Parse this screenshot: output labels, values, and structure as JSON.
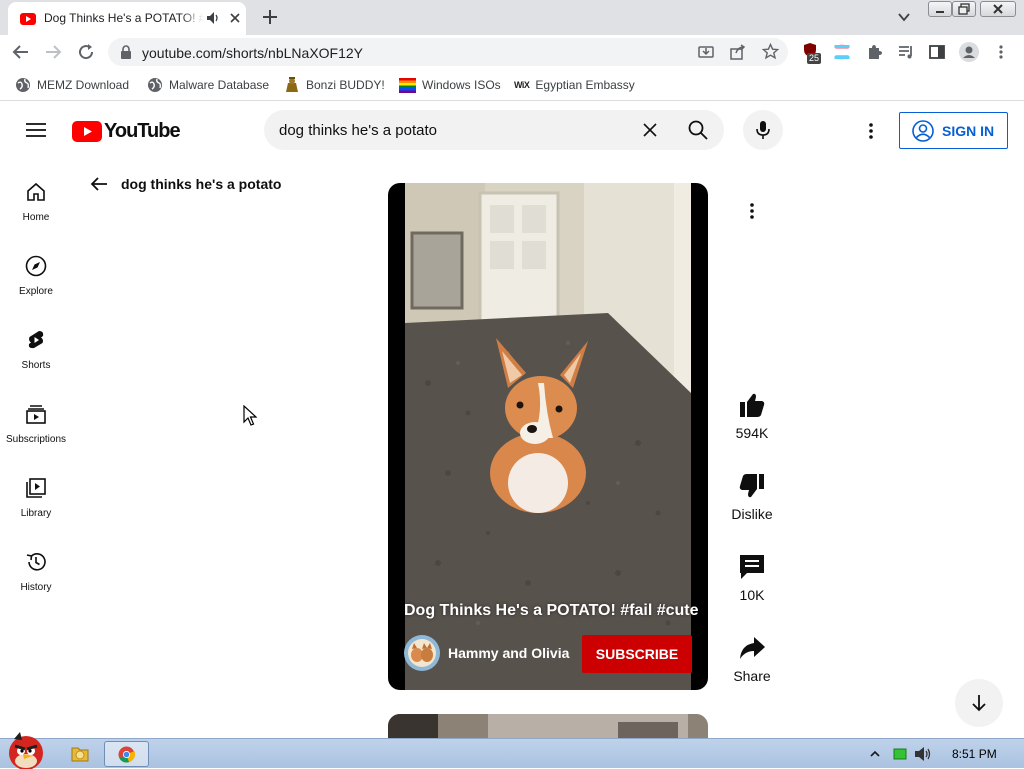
{
  "browser": {
    "tab": {
      "title": "Dog Thinks He's a POTATO! #fail #cute - YouTube"
    },
    "url": "youtube.com/shorts/nbLNaXOF12Y",
    "extension_badge": "25",
    "bookmarks": [
      {
        "label": "MEMZ Download",
        "icon": "globe-icon"
      },
      {
        "label": "Malware Database",
        "icon": "globe-icon"
      },
      {
        "label": "Bonzi BUDDY!",
        "icon": "bonzi-icon"
      },
      {
        "label": "Windows ISOs",
        "icon": "rainbow-flag-icon"
      },
      {
        "label": "Egyptian Embassy",
        "icon": "wix-icon"
      }
    ]
  },
  "youtube": {
    "logo_text": "YouTube",
    "search_query": "dog thinks he's a potato",
    "signin_label": "SIGN IN",
    "guide": [
      {
        "label": "Home",
        "icon": "home-icon"
      },
      {
        "label": "Explore",
        "icon": "compass-icon"
      },
      {
        "label": "Shorts",
        "icon": "shorts-icon"
      },
      {
        "label": "Subscriptions",
        "icon": "subscriptions-icon"
      },
      {
        "label": "Library",
        "icon": "library-icon"
      },
      {
        "label": "History",
        "icon": "history-icon"
      }
    ],
    "back_label": "dog thinks he's a potato",
    "short": {
      "title": "Dog Thinks He's a POTATO! #fail #cute",
      "channel": "Hammy and Olivia",
      "subscribe_label": "SUBSCRIBE"
    },
    "actions": {
      "likes": "594K",
      "dislike_label": "Dislike",
      "comments": "10K",
      "share_label": "Share"
    }
  },
  "taskbar": {
    "clock": "8:51 PM"
  },
  "colors": {
    "yt_red": "#ff0000",
    "subscribe_red": "#cc0000",
    "signin_blue": "#065fd4"
  }
}
